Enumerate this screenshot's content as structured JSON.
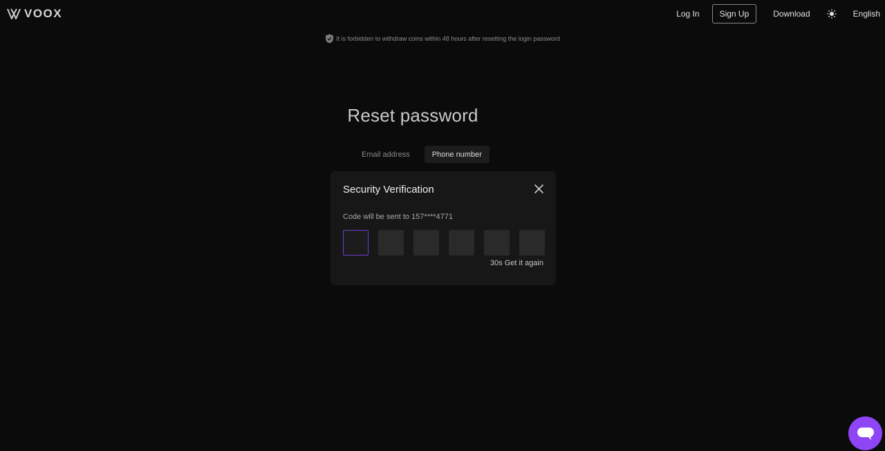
{
  "header": {
    "logo_text": "VOOX",
    "nav": {
      "login": "Log In",
      "signup": "Sign Up",
      "download": "Download",
      "language": "English"
    }
  },
  "notice": {
    "text": "It is forbidden to withdraw coins within 48 hours after resetting the login password"
  },
  "page_title": "Reset password",
  "tabs": [
    {
      "label": "Email address",
      "active": false
    },
    {
      "label": "Phone number",
      "active": true
    }
  ],
  "modal": {
    "title": "Security Verification",
    "subtitle": "Code will be sent to 157****4771",
    "code_length": 6,
    "resend_countdown": "30s",
    "resend_label": "Get it again"
  },
  "colors": {
    "background": "#0b0b0b",
    "modal_bg": "#171717",
    "accent": "#6c3fd0",
    "chat_button": "#8e45f5"
  },
  "icons": {
    "logo": "voox-logo-icon",
    "theme": "sun-icon",
    "notice": "shield-check-icon",
    "close": "close-icon",
    "chat": "chat-bubble-icon"
  }
}
